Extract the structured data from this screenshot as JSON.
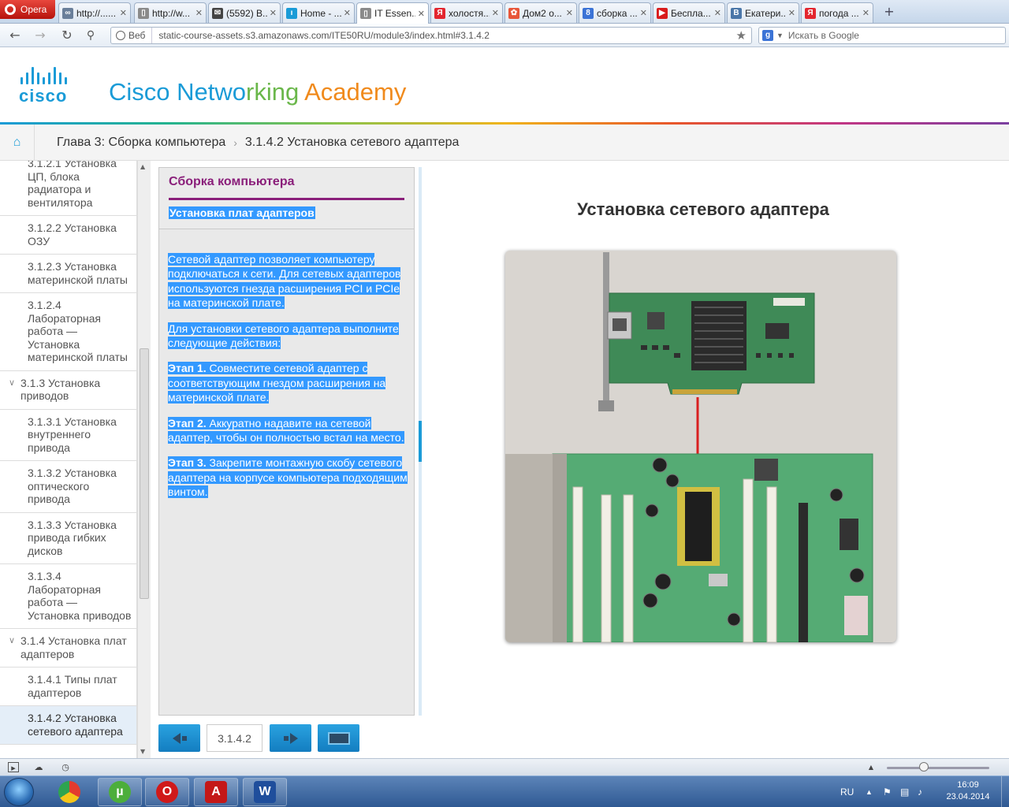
{
  "browser": {
    "menu_label": "Opera",
    "tabs": [
      {
        "label": "http://......",
        "icon": "link-icon",
        "color": "#6a7f9a"
      },
      {
        "label": "http://w...",
        "icon": "page-icon",
        "color": "#8a8a8a"
      },
      {
        "label": "(5592) В...",
        "icon": "mail-icon",
        "color": "#444444"
      },
      {
        "label": "Home - ...",
        "icon": "cisco-icon",
        "color": "#1a9bd7"
      },
      {
        "label": "IT Essen...",
        "icon": "page-icon",
        "color": "#8a8a8a",
        "active": true
      },
      {
        "label": "холостя...",
        "icon": "yandex-icon",
        "color": "#e3262f"
      },
      {
        "label": "Дом2 о...",
        "icon": "flower-icon",
        "color": "#e8563a"
      },
      {
        "label": "сборка ...",
        "icon": "google-icon",
        "color": "#3b73d6"
      },
      {
        "label": "Беспла...",
        "icon": "youtube-icon",
        "color": "#d91c1c"
      },
      {
        "label": "Екатери...",
        "icon": "vk-icon",
        "color": "#4a76a8"
      },
      {
        "label": "погода ...",
        "icon": "yandex-icon",
        "color": "#e3262f"
      }
    ],
    "web_tag": "Веб",
    "url": "static-course-assets.s3.amazonaws.com/ITE50RU/module3/index.html#3.1.4.2",
    "search_placeholder": "Искать в Google",
    "search_engine_letter": "g"
  },
  "header": {
    "logo_word": "cisco",
    "title_part1": "Cisco Netwo",
    "title_part2": "rking ",
    "title_part3": "Academy"
  },
  "breadcrumb": {
    "chapter": "Глава 3: Сборка компьютера",
    "separator": "›",
    "page": "3.1.4.2 Установка сетевого адаптера"
  },
  "toc": {
    "items": [
      {
        "label": "3.1.2.1 Установка ЦП, блока радиатора и вентилятора",
        "type": "item"
      },
      {
        "label": "3.1.2.2 Установка ОЗУ",
        "type": "item"
      },
      {
        "label": "3.1.2.3 Установка материнской платы",
        "type": "item"
      },
      {
        "label": "3.1.2.4 Лабораторная работа — Установка материнской платы",
        "type": "item"
      },
      {
        "label": "3.1.3 Установка приводов",
        "type": "section"
      },
      {
        "label": "3.1.3.1 Установка внутреннего привода",
        "type": "item"
      },
      {
        "label": "3.1.3.2 Установка оптического привода",
        "type": "item"
      },
      {
        "label": "3.1.3.3 Установка привода гибких дисков",
        "type": "item"
      },
      {
        "label": "3.1.3.4 Лабораторная работа — Установка приводов",
        "type": "item"
      },
      {
        "label": "3.1.4 Установка плат адаптеров",
        "type": "section"
      },
      {
        "label": "3.1.4.1 Типы плат адаптеров",
        "type": "item"
      },
      {
        "label": "3.1.4.2 Установка сетевого адаптера",
        "type": "active"
      }
    ]
  },
  "panel": {
    "heading": "Сборка компьютера",
    "subheading": "Установка плат адаптеров",
    "para1": "Сетевой адаптер позволяет компьютеру подключаться к сети. Для сетевых адаптеров используются гнезда расширения PCI и PCIe на материнской плате.",
    "para2": "Для установки сетевого адаптера выполните следующие действия:",
    "step1_label": "Этап 1.",
    "step1_text": " Совместите сетевой адаптер с соответствующим гнездом расширения на материнской плате.",
    "step2_label": "Этап 2.",
    "step2_text": " Аккуратно надавите на сетевой адаптер, чтобы он полностью встал на место.",
    "step3_label": "Этап 3.",
    "step3_text": " Закрепите монтажную скобу сетевого адаптера на корпусе компьютера подходящим винтом."
  },
  "nav": {
    "page_number": "3.1.4.2"
  },
  "content": {
    "title": "Установка сетевого адаптера"
  },
  "taskbar": {
    "language": "RU",
    "time": "16:09",
    "date": "23.04.2014"
  }
}
